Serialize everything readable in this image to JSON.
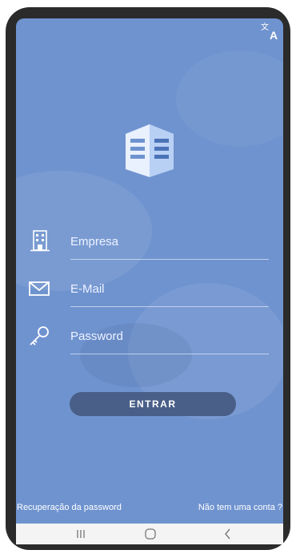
{
  "toolbar": {
    "translate_icon": "translate-icon"
  },
  "logo": {
    "icon": "building-logo-icon"
  },
  "form": {
    "company": {
      "placeholder": "Empresa",
      "value": "",
      "icon": "building-icon"
    },
    "email": {
      "placeholder": "E-Mail",
      "value": "",
      "icon": "envelope-icon"
    },
    "password": {
      "placeholder": "Password",
      "value": "",
      "icon": "key-icon"
    }
  },
  "actions": {
    "login_label": "ENTRAR",
    "recover_label": "Recuperação da password",
    "signup_label": "Não tem uma conta ?"
  },
  "navbar": {
    "recents_icon": "recents-icon",
    "home_icon": "home-icon",
    "back_icon": "back-icon"
  },
  "colors": {
    "background": "#6f93cf",
    "button": "#495f88",
    "text": "#ffffff"
  }
}
